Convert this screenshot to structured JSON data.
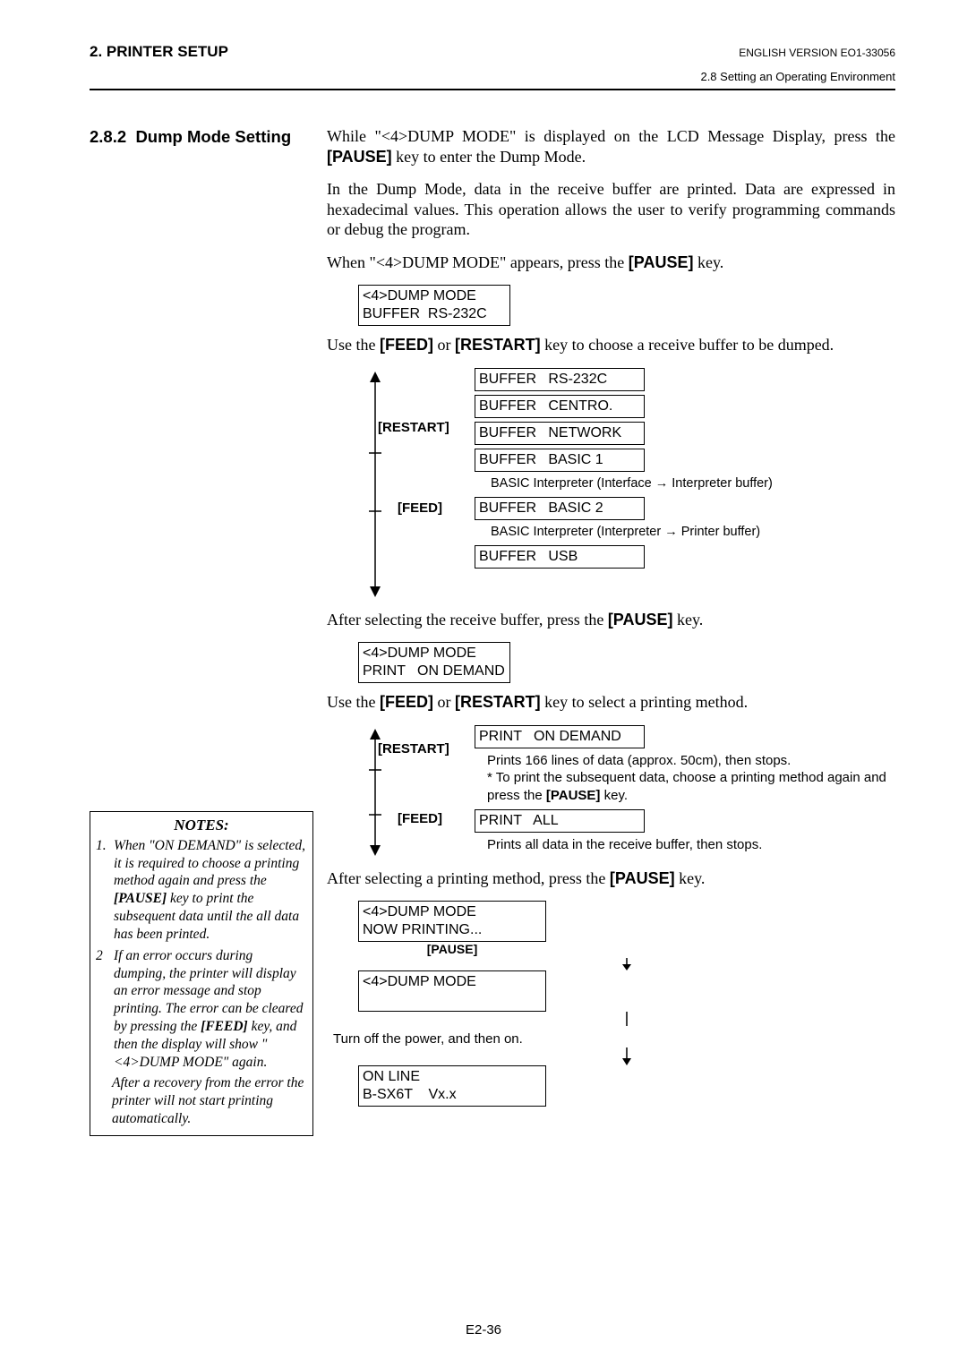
{
  "header": {
    "left": "2. PRINTER SETUP",
    "right": "ENGLISH VERSION EO1-33056",
    "sub": "2.8 Setting an Operating Environment"
  },
  "section_title_num": "2.8.2",
  "section_title_text": "Dump Mode Setting",
  "body": {
    "p1a": "While \"<4>DUMP MODE\" is displayed on the LCD Message Display, press the ",
    "p1b": "[PAUSE]",
    "p1c": " key to enter the Dump Mode.",
    "p2": "In the Dump Mode, data in the receive buffer are printed.  Data are expressed in hexadecimal values.  This operation allows the user to verify programming commands or debug the program.",
    "p3a": "When \"<4>DUMP MODE\" appears, press the ",
    "p3b": "[PAUSE]",
    "p3c": " key.",
    "lcd1": "<4>DUMP MODE\nBUFFER  RS-232C",
    "p4a": "Use the ",
    "p4b": "[FEED]",
    "p4c": " or ",
    "p4d": "[RESTART]",
    "p4e": " key to choose a receive buffer to be dumped.",
    "restart": "[RESTART]",
    "feed": "[FEED]",
    "buffers": {
      "b1": "BUFFER   RS-232C",
      "b2": "BUFFER   CENTRO.",
      "b3": "BUFFER   NETWORK",
      "b4": "BUFFER   BASIC 1",
      "b4note": "BASIC Interpreter (Interface → Interpreter buffer)",
      "b5": "BUFFER   BASIC 2",
      "b5note": "BASIC Interpreter (Interpreter → Printer buffer)",
      "b6": "BUFFER   USB"
    },
    "p5a": "After selecting the receive buffer, press the ",
    "p5b": "[PAUSE]",
    "p5c": " key.",
    "lcd2": "<4>DUMP MODE\nPRINT   ON DEMAND",
    "p6a": "Use the ",
    "p6b": "[FEED]",
    "p6c": " or ",
    "p6d": "[RESTART]",
    "p6e": " key to select a printing method.",
    "print_ondemand": "PRINT   ON DEMAND",
    "print_ondemand_desc1": "Prints 166 lines of data (approx. 50cm), then stops.",
    "print_ondemand_desc2a": "* To print the subsequent data, choose a printing method again and press the ",
    "print_ondemand_desc2b": "[PAUSE]",
    "print_ondemand_desc2c": " key.",
    "print_all": "PRINT   ALL",
    "print_all_desc": "Prints all data in the receive buffer, then stops.",
    "p7a": "After selecting a printing method, press the ",
    "p7b": "[PAUSE]",
    "p7c": " key.",
    "final": {
      "lcd_printing": "<4>DUMP MODE\nNOW PRINTING...",
      "pause": "[PAUSE]",
      "lcd_blank": "<4>DUMP MODE\n ",
      "turnoff": "Turn off the power, and then on.",
      "lcd_online": "ON LINE\nB-SX6T    Vx.x"
    }
  },
  "notes": {
    "title": "NOTES:",
    "n1a": "When \"ON DEMAND\" is selected, it is required to choose a printing method again and press the ",
    "n1b": "[PAUSE]",
    "n1c": " key to print the subsequent data until the all data has been printed.",
    "n2": " If an error occurs during dumping, the printer will display an error message and stop printing.  The error can be cleared by pressing the ",
    "n2b": "[FEED]",
    "n2c": " key, and then the display will show \"<4>DUMP MODE\" again.",
    "n2trail": "After a recovery from the error the printer will not start printing automatically."
  },
  "page_num": "E2-36"
}
